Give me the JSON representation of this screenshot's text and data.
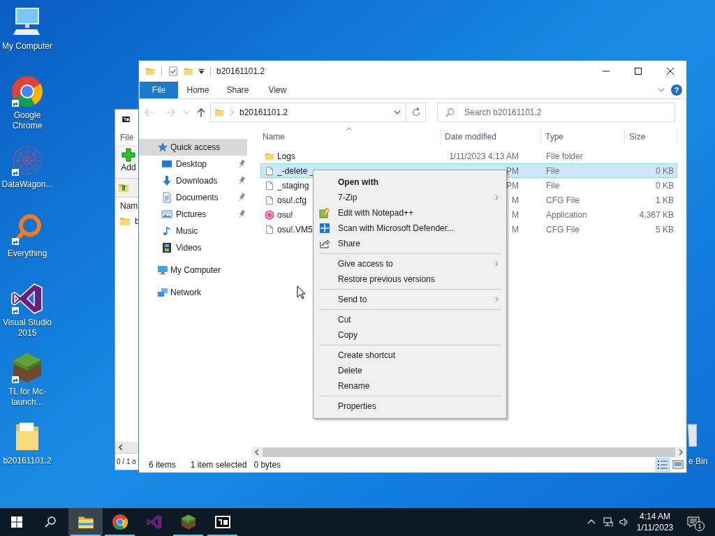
{
  "desktop_icons": [
    {
      "label": "My Computer",
      "shortcut": false
    },
    {
      "label": "Google Chrome",
      "shortcut": true
    },
    {
      "label": "DataWagon...",
      "shortcut": true
    },
    {
      "label": "Everything",
      "shortcut": true
    },
    {
      "label": "Visual Studio 2015",
      "shortcut": true
    },
    {
      "label": "TL for Mc-launch...",
      "shortcut": true
    },
    {
      "label": "b20161101.2",
      "shortcut": false
    }
  ],
  "recycle_bin_label": "e Bin",
  "background_window": {
    "menu": "File",
    "toolbar_button": "Add",
    "column": "Nam",
    "row": "b",
    "status": "0 / 1 o"
  },
  "explorer": {
    "title": "b20161101.2",
    "ribbon_tabs": [
      {
        "label": "File",
        "kind": "file"
      },
      {
        "label": "Home",
        "kind": "tab"
      },
      {
        "label": "Share",
        "kind": "tab"
      },
      {
        "label": "View",
        "kind": "tab"
      }
    ],
    "help": "?",
    "address": "b20161101.2",
    "search": {
      "placeholder": "Search b20161101.2"
    },
    "nav": [
      {
        "label": "Quick access",
        "selected": true,
        "children": [
          {
            "label": "Desktop",
            "pinned": true,
            "selected": false
          },
          {
            "label": "Downloads",
            "pinned": true,
            "selected": false
          },
          {
            "label": "Documents",
            "pinned": true,
            "selected": false
          },
          {
            "label": "Pictures",
            "pinned": true,
            "selected": false
          },
          {
            "label": "Music",
            "pinned": false,
            "selected": false
          },
          {
            "label": "Videos",
            "pinned": false,
            "selected": false
          }
        ]
      },
      {
        "label": "My Computer",
        "selected": false
      },
      {
        "label": "Network",
        "selected": false
      }
    ],
    "columns": [
      "Name",
      "Date modified",
      "Type",
      "Size"
    ],
    "rows": [
      {
        "kind": "folder",
        "name": "Logs",
        "date": "1/11/2023 4:13 AM",
        "type": "File folder",
        "selected": false
      },
      {
        "kind": "file",
        "name": "_-delete _",
        "date": "PM",
        "type": "File",
        "size": "0 KB",
        "selected": true
      },
      {
        "kind": "file",
        "name": "_staging",
        "date": "PM",
        "type": "File",
        "size": "0 KB",
        "selected": false
      },
      {
        "kind": "file",
        "name": "osu!.cfg",
        "date": "M",
        "type": "CFG File",
        "size": "1 KB",
        "selected": false
      },
      {
        "kind": "app",
        "name": "osu!",
        "date": "M",
        "type": "Application",
        "size": "4,367 KB",
        "selected": false
      },
      {
        "kind": "file",
        "name": "osu!.VM5",
        "date": "M",
        "type": "CFG File",
        "size": "5 KB",
        "selected": false
      }
    ],
    "status": {
      "items": "6 items",
      "selection": "1 item selected",
      "size": "0 bytes"
    },
    "view_buttons": [
      {
        "kind": "details",
        "selected": true
      },
      {
        "kind": "large-icons",
        "selected": false
      }
    ]
  },
  "context_menu": [
    {
      "kind": "item",
      "label": "Open with",
      "default": true,
      "submenu": false
    },
    {
      "kind": "item",
      "label": "7-Zip",
      "default": false,
      "submenu": true
    },
    {
      "kind": "item",
      "label": "Edit with Notepad++",
      "default": false,
      "submenu": false
    },
    {
      "kind": "item",
      "label": "Scan with Microsoft Defender...",
      "default": false,
      "submenu": false
    },
    {
      "kind": "item",
      "label": "Share",
      "default": false,
      "submenu": false
    },
    {
      "kind": "separator"
    },
    {
      "kind": "item",
      "label": "Give access to",
      "default": false,
      "submenu": true
    },
    {
      "kind": "item",
      "label": "Restore previous versions",
      "default": false,
      "submenu": false
    },
    {
      "kind": "separator"
    },
    {
      "kind": "item",
      "label": "Send to",
      "default": false,
      "submenu": true
    },
    {
      "kind": "separator"
    },
    {
      "kind": "item",
      "label": "Cut",
      "default": false,
      "submenu": false
    },
    {
      "kind": "item",
      "label": "Copy",
      "default": false,
      "submenu": false
    },
    {
      "kind": "separator"
    },
    {
      "kind": "item",
      "label": "Create shortcut",
      "default": false,
      "submenu": false
    },
    {
      "kind": "item",
      "label": "Delete",
      "default": false,
      "submenu": false
    },
    {
      "kind": "item",
      "label": "Rename",
      "default": false,
      "submenu": false
    },
    {
      "kind": "separator"
    },
    {
      "kind": "item",
      "label": "Properties",
      "default": false,
      "submenu": false
    }
  ],
  "taskbar": {
    "apps": [
      {
        "selected": true,
        "running": true
      },
      {
        "selected": false,
        "running": true
      },
      {
        "selected": false,
        "running": false
      },
      {
        "selected": false,
        "running": true
      },
      {
        "selected": false,
        "running": true
      }
    ],
    "time": "4:14 AM",
    "date": "1/11/2023",
    "notifications": "1"
  }
}
